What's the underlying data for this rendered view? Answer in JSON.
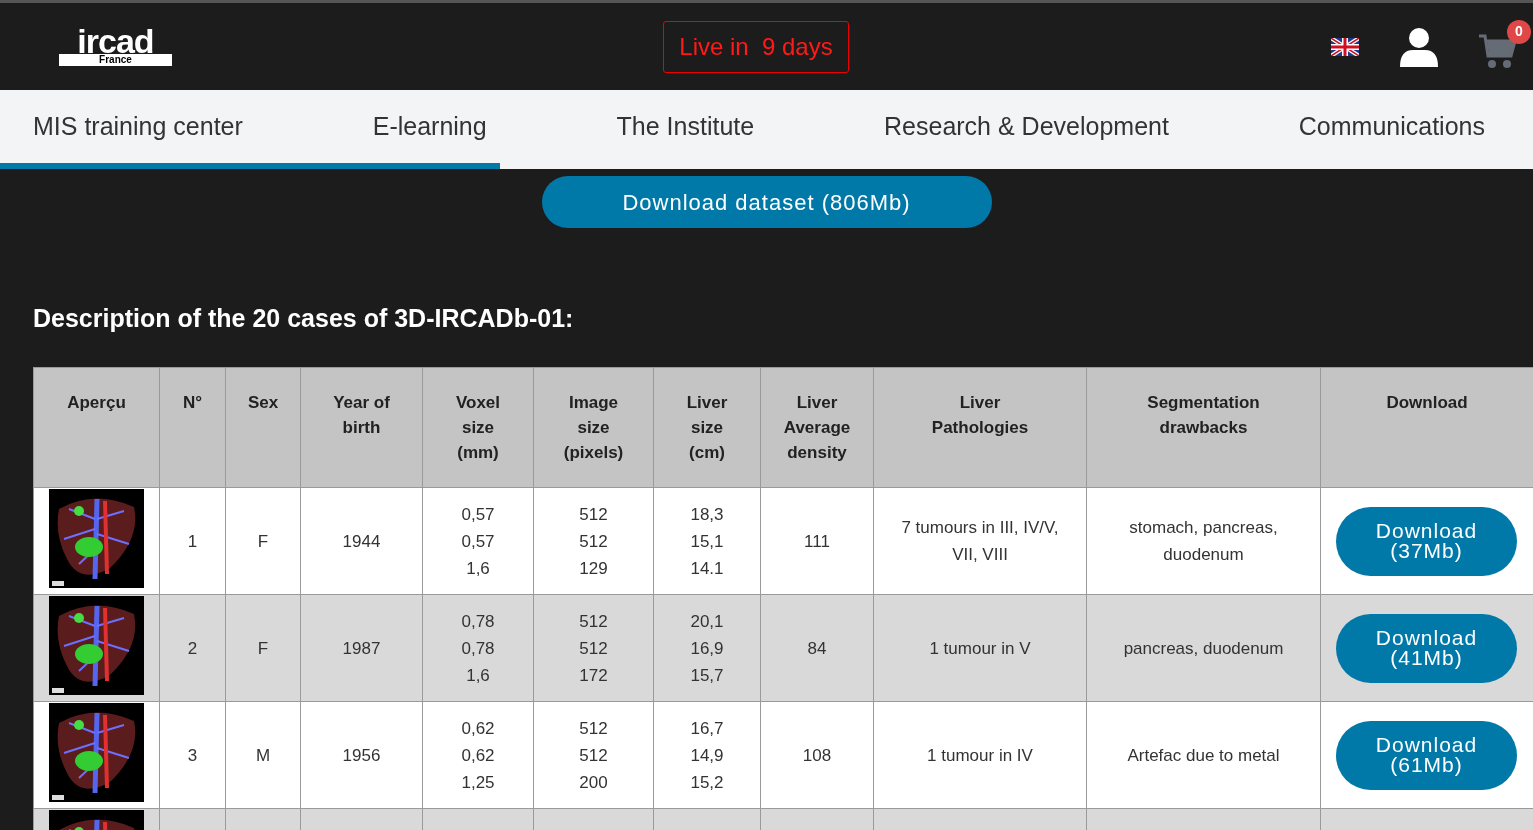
{
  "header": {
    "logo": {
      "wordmark": "ircad",
      "country": "France"
    },
    "countdown": "Live in  9 days",
    "cart": {
      "count": "0"
    }
  },
  "nav": {
    "items": [
      {
        "label": "MIS training center"
      },
      {
        "label": "E-learning"
      },
      {
        "label": "The Institute"
      },
      {
        "label": "Research & Development"
      },
      {
        "label": "Communications"
      }
    ],
    "scroll_progress": {
      "level": 0.326
    }
  },
  "download_dataset_button": "Download dataset (806Mb)",
  "section_title": "Description of the 20 cases of 3D-IRCADb-01:",
  "table": {
    "columns": [
      "Aperçu",
      "N°",
      "Sex",
      "Year of\nbirth",
      "Voxel\nsize\n(mm)",
      "Image\nsize\n(pixels)",
      "Liver\nsize\n(cm)",
      "Liver\nAverage\ndensity",
      "Liver\nPathologies",
      "Segmentation\ndrawbacks",
      "Download"
    ],
    "rows": [
      {
        "thumbnail": {
          "kind": "picture"
        },
        "number": "1",
        "sex": "F",
        "year_of_birth": "1944",
        "voxel_size": "0,57\n0,57\n1,6",
        "image_size": "512\n512\n129",
        "liver_size": "18,3\n15,1\n14.1",
        "liver_average_density": "111",
        "liver_pathologies": "7 tumours in III, IV/V,\nVII, VIII",
        "segmentation_drawbacks": "stomach, pancreas,\nduodenum",
        "download": "Download\n(37Mb)"
      },
      {
        "thumbnail": {
          "kind": "picture"
        },
        "number": "2",
        "sex": "F",
        "year_of_birth": "1987",
        "voxel_size": "0,78\n0,78\n1,6",
        "image_size": "512\n512\n172",
        "liver_size": "20,1\n16,9\n15,7",
        "liver_average_density": "84",
        "liver_pathologies": "1 tumour in V",
        "segmentation_drawbacks": "pancreas, duodenum",
        "download": "Download\n(41Mb)"
      },
      {
        "thumbnail": {
          "kind": "picture"
        },
        "number": "3",
        "sex": "M",
        "year_of_birth": "1956",
        "voxel_size": "0,62\n0,62\n1,25",
        "image_size": "512\n512\n200",
        "liver_size": "16,7\n14,9\n15,2",
        "liver_average_density": "108",
        "liver_pathologies": "1 tumour in IV",
        "segmentation_drawbacks": "Artefac due to metal",
        "download": "Download\n(61Mb)"
      },
      {
        "thumbnail": {
          "kind": "picture"
        }
      }
    ]
  }
}
